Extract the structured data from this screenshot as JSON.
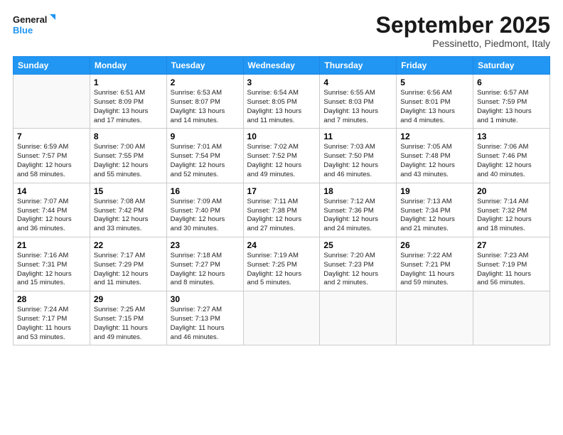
{
  "logo": {
    "line1": "General",
    "line2": "Blue"
  },
  "title": "September 2025",
  "subtitle": "Pessinetto, Piedmont, Italy",
  "days_of_week": [
    "Sunday",
    "Monday",
    "Tuesday",
    "Wednesday",
    "Thursday",
    "Friday",
    "Saturday"
  ],
  "weeks": [
    [
      {
        "num": "",
        "info": ""
      },
      {
        "num": "1",
        "info": "Sunrise: 6:51 AM\nSunset: 8:09 PM\nDaylight: 13 hours\nand 17 minutes."
      },
      {
        "num": "2",
        "info": "Sunrise: 6:53 AM\nSunset: 8:07 PM\nDaylight: 13 hours\nand 14 minutes."
      },
      {
        "num": "3",
        "info": "Sunrise: 6:54 AM\nSunset: 8:05 PM\nDaylight: 13 hours\nand 11 minutes."
      },
      {
        "num": "4",
        "info": "Sunrise: 6:55 AM\nSunset: 8:03 PM\nDaylight: 13 hours\nand 7 minutes."
      },
      {
        "num": "5",
        "info": "Sunrise: 6:56 AM\nSunset: 8:01 PM\nDaylight: 13 hours\nand 4 minutes."
      },
      {
        "num": "6",
        "info": "Sunrise: 6:57 AM\nSunset: 7:59 PM\nDaylight: 13 hours\nand 1 minute."
      }
    ],
    [
      {
        "num": "7",
        "info": "Sunrise: 6:59 AM\nSunset: 7:57 PM\nDaylight: 12 hours\nand 58 minutes."
      },
      {
        "num": "8",
        "info": "Sunrise: 7:00 AM\nSunset: 7:55 PM\nDaylight: 12 hours\nand 55 minutes."
      },
      {
        "num": "9",
        "info": "Sunrise: 7:01 AM\nSunset: 7:54 PM\nDaylight: 12 hours\nand 52 minutes."
      },
      {
        "num": "10",
        "info": "Sunrise: 7:02 AM\nSunset: 7:52 PM\nDaylight: 12 hours\nand 49 minutes."
      },
      {
        "num": "11",
        "info": "Sunrise: 7:03 AM\nSunset: 7:50 PM\nDaylight: 12 hours\nand 46 minutes."
      },
      {
        "num": "12",
        "info": "Sunrise: 7:05 AM\nSunset: 7:48 PM\nDaylight: 12 hours\nand 43 minutes."
      },
      {
        "num": "13",
        "info": "Sunrise: 7:06 AM\nSunset: 7:46 PM\nDaylight: 12 hours\nand 40 minutes."
      }
    ],
    [
      {
        "num": "14",
        "info": "Sunrise: 7:07 AM\nSunset: 7:44 PM\nDaylight: 12 hours\nand 36 minutes."
      },
      {
        "num": "15",
        "info": "Sunrise: 7:08 AM\nSunset: 7:42 PM\nDaylight: 12 hours\nand 33 minutes."
      },
      {
        "num": "16",
        "info": "Sunrise: 7:09 AM\nSunset: 7:40 PM\nDaylight: 12 hours\nand 30 minutes."
      },
      {
        "num": "17",
        "info": "Sunrise: 7:11 AM\nSunset: 7:38 PM\nDaylight: 12 hours\nand 27 minutes."
      },
      {
        "num": "18",
        "info": "Sunrise: 7:12 AM\nSunset: 7:36 PM\nDaylight: 12 hours\nand 24 minutes."
      },
      {
        "num": "19",
        "info": "Sunrise: 7:13 AM\nSunset: 7:34 PM\nDaylight: 12 hours\nand 21 minutes."
      },
      {
        "num": "20",
        "info": "Sunrise: 7:14 AM\nSunset: 7:32 PM\nDaylight: 12 hours\nand 18 minutes."
      }
    ],
    [
      {
        "num": "21",
        "info": "Sunrise: 7:16 AM\nSunset: 7:31 PM\nDaylight: 12 hours\nand 15 minutes."
      },
      {
        "num": "22",
        "info": "Sunrise: 7:17 AM\nSunset: 7:29 PM\nDaylight: 12 hours\nand 11 minutes."
      },
      {
        "num": "23",
        "info": "Sunrise: 7:18 AM\nSunset: 7:27 PM\nDaylight: 12 hours\nand 8 minutes."
      },
      {
        "num": "24",
        "info": "Sunrise: 7:19 AM\nSunset: 7:25 PM\nDaylight: 12 hours\nand 5 minutes."
      },
      {
        "num": "25",
        "info": "Sunrise: 7:20 AM\nSunset: 7:23 PM\nDaylight: 12 hours\nand 2 minutes."
      },
      {
        "num": "26",
        "info": "Sunrise: 7:22 AM\nSunset: 7:21 PM\nDaylight: 11 hours\nand 59 minutes."
      },
      {
        "num": "27",
        "info": "Sunrise: 7:23 AM\nSunset: 7:19 PM\nDaylight: 11 hours\nand 56 minutes."
      }
    ],
    [
      {
        "num": "28",
        "info": "Sunrise: 7:24 AM\nSunset: 7:17 PM\nDaylight: 11 hours\nand 53 minutes."
      },
      {
        "num": "29",
        "info": "Sunrise: 7:25 AM\nSunset: 7:15 PM\nDaylight: 11 hours\nand 49 minutes."
      },
      {
        "num": "30",
        "info": "Sunrise: 7:27 AM\nSunset: 7:13 PM\nDaylight: 11 hours\nand 46 minutes."
      },
      {
        "num": "",
        "info": ""
      },
      {
        "num": "",
        "info": ""
      },
      {
        "num": "",
        "info": ""
      },
      {
        "num": "",
        "info": ""
      }
    ]
  ]
}
